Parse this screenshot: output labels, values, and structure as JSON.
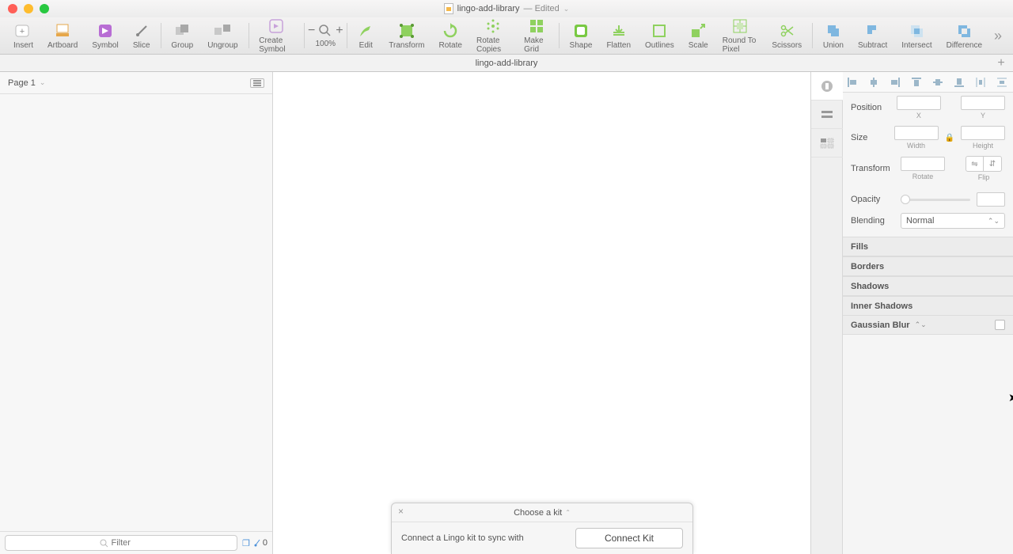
{
  "title": {
    "filename": "lingo-add-library",
    "edited": "— Edited"
  },
  "toolbar": {
    "insert": "Insert",
    "artboard": "Artboard",
    "symbol": "Symbol",
    "slice": "Slice",
    "group": "Group",
    "ungroup": "Ungroup",
    "create_symbol": "Create Symbol",
    "zoom": "100%",
    "edit": "Edit",
    "transform": "Transform",
    "rotate": "Rotate",
    "rotate_copies": "Rotate Copies",
    "make_grid": "Make Grid",
    "shape": "Shape",
    "flatten": "Flatten",
    "outlines": "Outlines",
    "scale": "Scale",
    "round_to_pixel": "Round To Pixel",
    "scissors": "Scissors",
    "union": "Union",
    "subtract": "Subtract",
    "intersect": "Intersect",
    "difference": "Difference"
  },
  "tab": "lingo-add-library",
  "left": {
    "page": "Page 1",
    "filter_placeholder": "Filter",
    "count": "0"
  },
  "inspector": {
    "position": "Position",
    "x": "X",
    "y": "Y",
    "size": "Size",
    "width": "Width",
    "height": "Height",
    "transform": "Transform",
    "rotate": "Rotate",
    "flip": "Flip",
    "opacity": "Opacity",
    "blending": "Blending",
    "blending_value": "Normal",
    "fills": "Fills",
    "borders": "Borders",
    "shadows": "Shadows",
    "inner_shadows": "Inner Shadows",
    "gaussian_blur": "Gaussian Blur"
  },
  "lingo": {
    "choose": "Choose a kit",
    "msg": "Connect a Lingo kit to sync with",
    "btn": "Connect Kit"
  }
}
